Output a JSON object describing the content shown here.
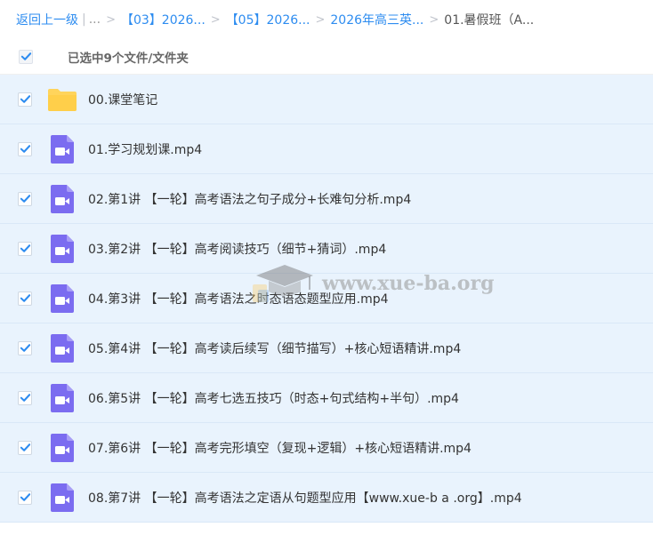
{
  "breadcrumb": {
    "back_label": "返回上一级",
    "ellipsis": "...",
    "items": [
      "【03】2026...",
      "【05】2026...",
      "2026年高三英..."
    ],
    "current": "01.暑假班（A..."
  },
  "selection": {
    "count_text": "已选中9个文件/文件夹",
    "all_checked": true
  },
  "files": [
    {
      "name": "00.课堂笔记",
      "type": "folder",
      "checked": true
    },
    {
      "name": "01.学习规划课.mp4",
      "type": "video",
      "checked": true
    },
    {
      "name": "02.第1讲 【一轮】高考语法之句子成分+长难句分析.mp4",
      "type": "video",
      "checked": true
    },
    {
      "name": "03.第2讲 【一轮】高考阅读技巧（细节+猜词）.mp4",
      "type": "video",
      "checked": true
    },
    {
      "name": "04.第3讲 【一轮】高考语法之时态语态题型应用.mp4",
      "type": "video",
      "checked": true
    },
    {
      "name": "05.第4讲 【一轮】高考读后续写（细节描写）+核心短语精讲.mp4",
      "type": "video",
      "checked": true
    },
    {
      "name": "06.第5讲 【一轮】高考七选五技巧（时态+句式结构+半句）.mp4",
      "type": "video",
      "checked": true
    },
    {
      "name": "07.第6讲 【一轮】高考完形填空（复现+逻辑）+核心短语精讲.mp4",
      "type": "video",
      "checked": true
    },
    {
      "name": "08.第7讲 【一轮】高考语法之定语从句题型应用【www.xue-b a .org】.mp4",
      "type": "video",
      "checked": true
    }
  ],
  "watermark": {
    "text": "www.xue-ba.org"
  },
  "colors": {
    "accent": "#2d8cf0",
    "row_selected": "#e9f3fd",
    "folder": "#ffd45b",
    "video": "#7b6cf0"
  },
  "icons": {
    "folder": "folder-icon",
    "video": "video-file-icon",
    "check": "checkmark-icon"
  }
}
